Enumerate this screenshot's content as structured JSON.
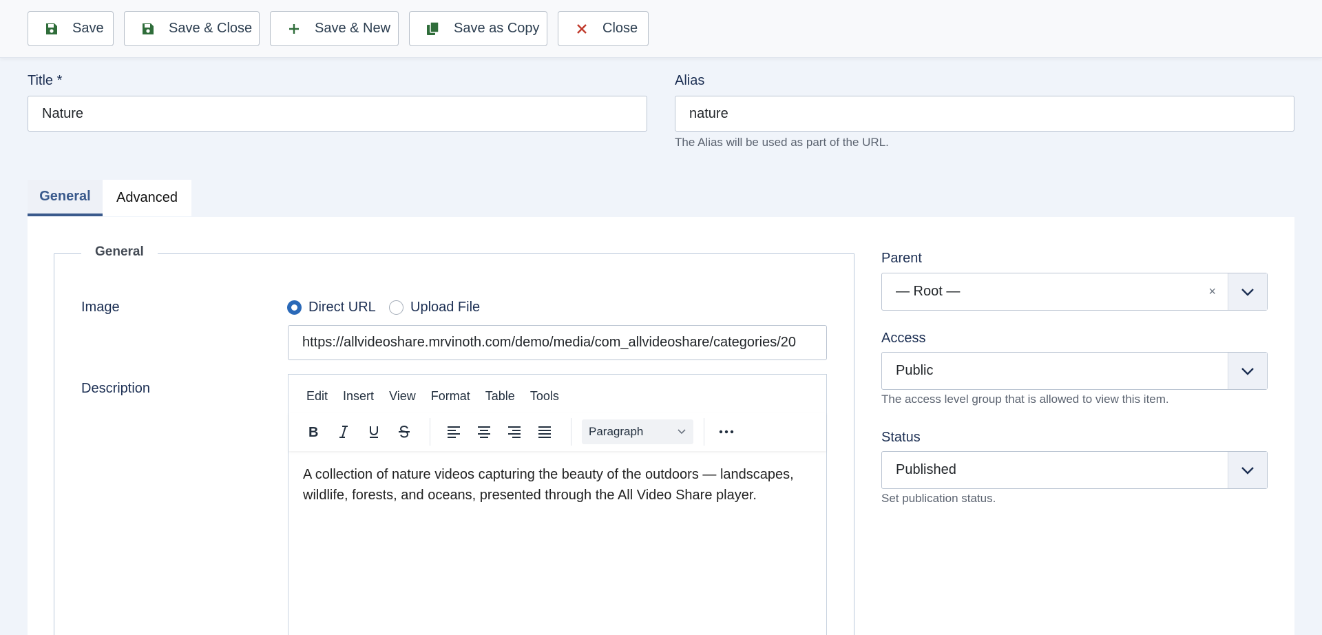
{
  "toolbar": {
    "save": "Save",
    "save_close": "Save & Close",
    "save_new": "Save & New",
    "save_copy": "Save as Copy",
    "close": "Close"
  },
  "form": {
    "title_label": "Title *",
    "title_value": "Nature",
    "alias_label": "Alias",
    "alias_value": "nature",
    "alias_help": "The Alias will be used as part of the URL."
  },
  "tabs": [
    {
      "label": "General",
      "active": true
    },
    {
      "label": "Advanced",
      "active": false
    }
  ],
  "general": {
    "legend": "General",
    "image_label": "Image",
    "radio_direct": "Direct URL",
    "radio_upload": "Upload File",
    "image_url": "https://allvideoshare.mrvinoth.com/demo/media/com_allvideoshare/categories/20",
    "description_label": "Description"
  },
  "editor": {
    "menu": [
      "Edit",
      "Insert",
      "View",
      "Format",
      "Table",
      "Tools"
    ],
    "block_format": "Paragraph",
    "content": "A collection of nature videos capturing the beauty of the outdoors — landscapes, wildlife, forests, and oceans, presented through the All Video Share player."
  },
  "sidebar": {
    "parent_label": "Parent",
    "parent_value": "— Root —",
    "clear_symbol": "×",
    "access_label": "Access",
    "access_value": "Public",
    "access_help": "The access level group that is allowed to view this item.",
    "status_label": "Status",
    "status_value": "Published",
    "status_help": "Set publication status."
  },
  "colors": {
    "accent": "#3a5a8c",
    "save_icon": "#2f6d3a",
    "close_icon": "#c0392b",
    "radio_on": "#2a69b8"
  },
  "icons": {
    "save": "floppy-disk-icon",
    "save_close": "floppy-disk-icon",
    "save_new": "plus-icon",
    "save_copy": "copy-icon",
    "close": "x-icon"
  }
}
